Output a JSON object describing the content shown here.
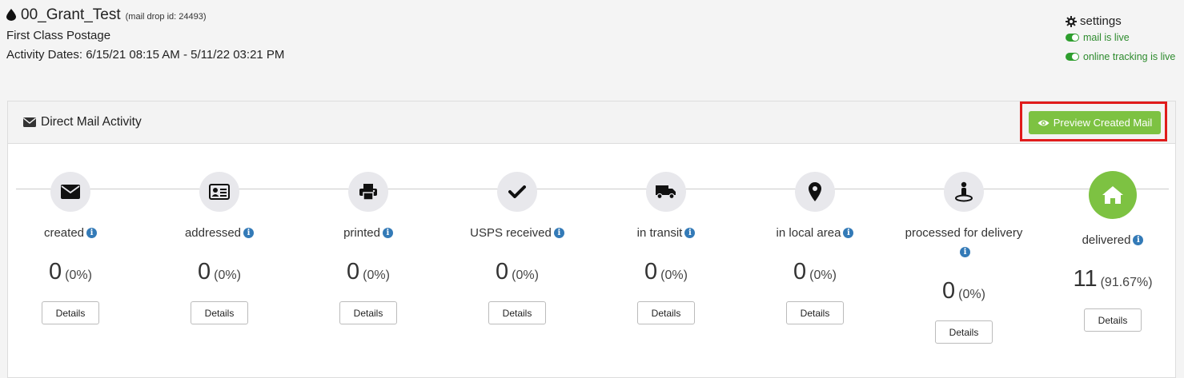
{
  "header": {
    "title": "00_Grant_Test",
    "mail_drop_id": "(mail drop id: 24493)",
    "postage": "First Class Postage",
    "activity_dates": "Activity Dates: 6/15/21 08:15 AM - 5/11/22 03:21 PM"
  },
  "settings": {
    "title": "settings",
    "mail_live": "mail is live",
    "tracking_live": "online tracking is live"
  },
  "panel": {
    "title": "Direct Mail Activity",
    "preview_button": "Preview Created Mail"
  },
  "steps": [
    {
      "label": "created",
      "count": "0",
      "percent": "(0%)",
      "button": "Details",
      "icon": "envelope-icon"
    },
    {
      "label": "addressed",
      "count": "0",
      "percent": "(0%)",
      "button": "Details",
      "icon": "address-card-icon"
    },
    {
      "label": "printed",
      "count": "0",
      "percent": "(0%)",
      "button": "Details",
      "icon": "printer-icon"
    },
    {
      "label": "USPS received",
      "count": "0",
      "percent": "(0%)",
      "button": "Details",
      "icon": "checkmark-icon"
    },
    {
      "label": "in transit",
      "count": "0",
      "percent": "(0%)",
      "button": "Details",
      "icon": "truck-icon"
    },
    {
      "label": "in local area",
      "count": "0",
      "percent": "(0%)",
      "button": "Details",
      "icon": "map-marker-icon"
    },
    {
      "label": "processed for delivery",
      "count": "0",
      "percent": "(0%)",
      "button": "Details",
      "icon": "street-view-icon"
    },
    {
      "label": "delivered",
      "count": "11",
      "percent": "(91.67%)",
      "button": "Details",
      "icon": "home-icon"
    }
  ],
  "colors": {
    "accent_green": "#7dc242",
    "live_green": "#2e8b2e",
    "info_blue": "#337ab7",
    "highlight_red": "#e01b1b"
  }
}
